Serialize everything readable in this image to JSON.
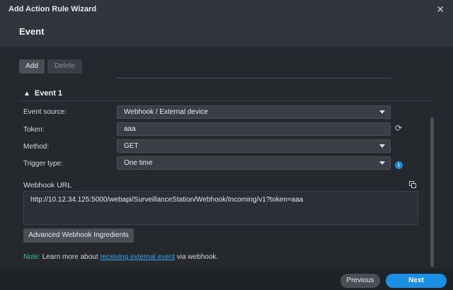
{
  "window": {
    "title": "Add Action Rule Wizard",
    "step_title": "Event"
  },
  "toolbar": {
    "add_label": "Add",
    "delete_label": "Delete"
  },
  "event": {
    "section_title": "Event 1",
    "fields": {
      "event_source": {
        "label": "Event source:",
        "value": "Webhook / External device"
      },
      "token": {
        "label": "Token:",
        "value": "aaa"
      },
      "method": {
        "label": "Method:",
        "value": "GET"
      },
      "trigger_type": {
        "label": "Trigger type:",
        "value": "One time"
      }
    },
    "webhook": {
      "label": "Webhook URL",
      "url": "http://10.12.34.125:5000/webapi/SurveillanceStation/Webhook/Incoming/v1?token=aaa"
    },
    "advanced_button": "Advanced Webhook Ingredients",
    "note": {
      "prefix": "Note:",
      "text_before": " Learn more about ",
      "link": "receiving external event",
      "text_after": " via webhook."
    }
  },
  "footer": {
    "previous_label": "Previous",
    "next_label": "Next"
  },
  "colors": {
    "accent": "#1a8fe3",
    "note_green": "#37c88a",
    "link": "#3aa0ec"
  }
}
